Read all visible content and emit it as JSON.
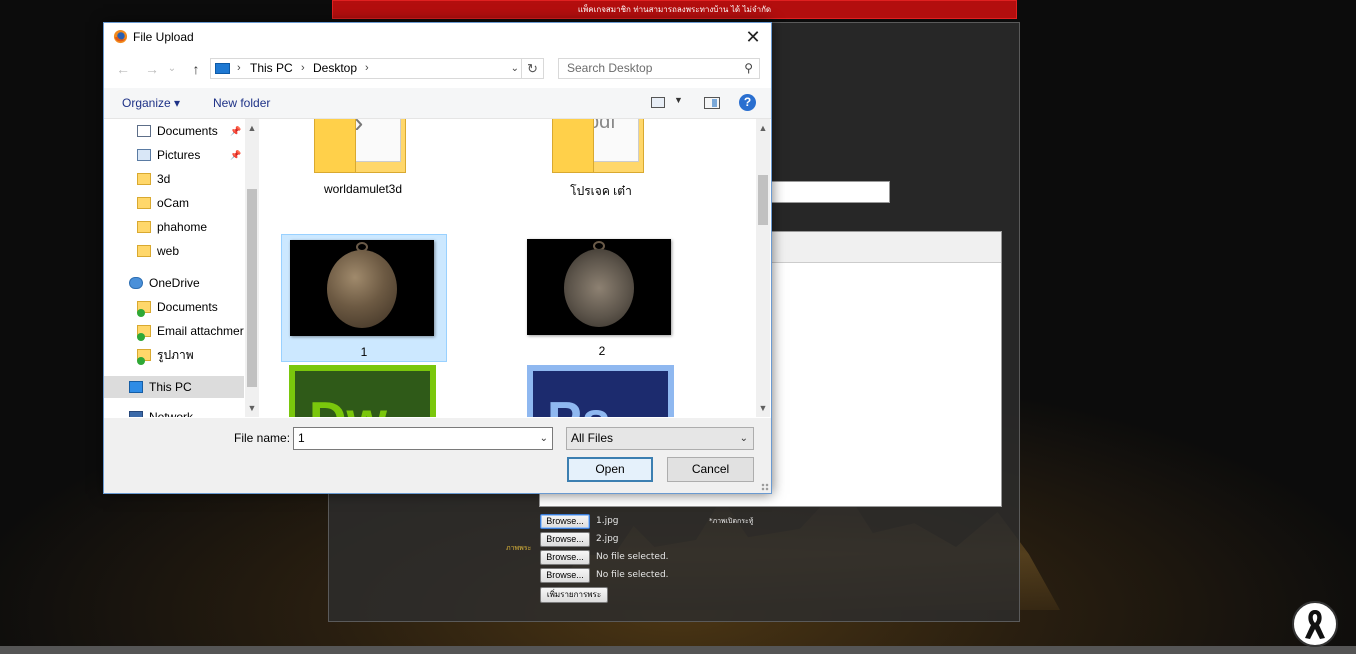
{
  "page": {
    "banner_text": "แพ็คเกจสมาชิก ท่านสามารถลงพระทางบ้าน ได้ ไม่จำกัด",
    "uploads": [
      {
        "button": "Browse...",
        "file": "1.jpg"
      },
      {
        "button": "Browse...",
        "file": "2.jpg"
      },
      {
        "button": "Browse...",
        "file": "No file selected."
      },
      {
        "button": "Browse...",
        "file": "No file selected."
      }
    ],
    "upload_note": "*ภาพเปิดกระทู้",
    "upload_side_label": "ภาพพระ",
    "add_item_button": "เพิ่มรายการพระ"
  },
  "dialog": {
    "title": "File Upload",
    "close_glyph": "✕",
    "nav": {
      "back": "←",
      "forward": "→",
      "recent": "⌄",
      "up": "↑"
    },
    "address": {
      "crumbs": [
        "This PC",
        "Desktop"
      ],
      "refresh": "↻"
    },
    "search_placeholder": "Search Desktop",
    "toolbar": {
      "organize": "Organize ▾",
      "new_folder": "New folder",
      "help": "?"
    },
    "nav_pane": [
      {
        "label": "Documents",
        "icon": "doc",
        "pinned": true
      },
      {
        "label": "Pictures",
        "icon": "pic",
        "pinned": true
      },
      {
        "label": "3d",
        "icon": "folder"
      },
      {
        "label": "oCam",
        "icon": "folder"
      },
      {
        "label": "phahome",
        "icon": "folder"
      },
      {
        "label": "web",
        "icon": "folder"
      },
      {
        "label": "OneDrive",
        "icon": "cloud"
      },
      {
        "label": "Documents",
        "icon": "folder",
        "synced": true
      },
      {
        "label": "Email attachmer",
        "icon": "folder",
        "synced": true
      },
      {
        "label": "รูปภาพ",
        "icon": "folder",
        "synced": true
      },
      {
        "label": "This PC",
        "icon": "pc",
        "selected": true
      },
      {
        "label": "Network",
        "icon": "net"
      }
    ],
    "files": [
      {
        "name": "worldamulet3d",
        "kind": "folder"
      },
      {
        "name": "โปรเจค เต๋า",
        "kind": "folder-pdf"
      },
      {
        "name": "1",
        "kind": "image-front",
        "selected": true
      },
      {
        "name": "2",
        "kind": "image-back"
      },
      {
        "name": "Dw",
        "kind": "app"
      },
      {
        "name": "Ps",
        "kind": "app"
      }
    ],
    "file_name_label": "File name:",
    "file_name_value": "1",
    "file_type": "All Files",
    "open_label": "Open",
    "cancel_label": "Cancel"
  },
  "colors": {
    "banner": "#b30e0e",
    "dialog_border": "#6a9ad1",
    "selection": "#cce8ff",
    "link": "#1e3287",
    "accent_yellow": "#d9b43a"
  }
}
